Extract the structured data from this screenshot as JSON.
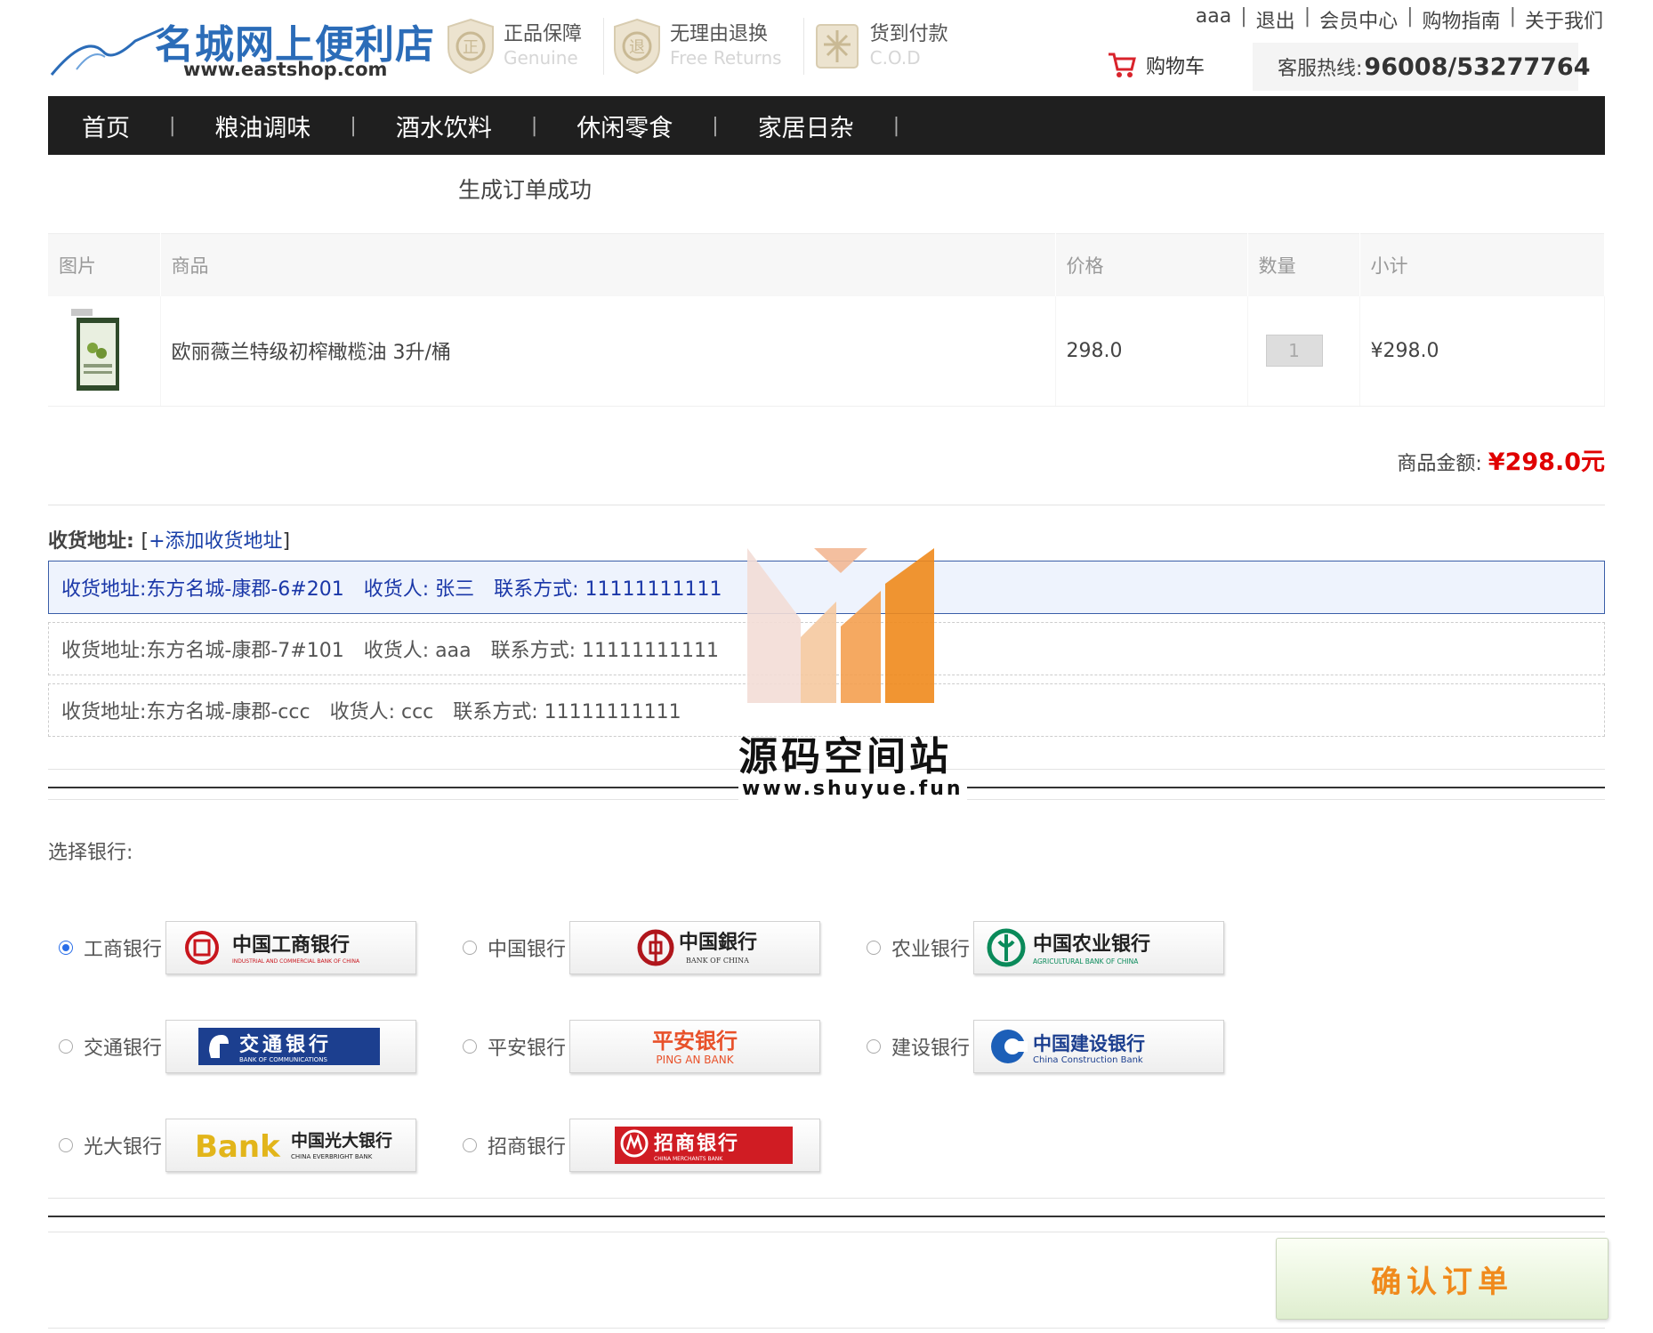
{
  "header": {
    "logo_title": "名城网上便利店",
    "logo_url": "www.eastshop.com",
    "guarantees": [
      {
        "main": "正品保障",
        "sub": "Genuine",
        "icon": "shield-genuine-icon"
      },
      {
        "main": "无理由退换",
        "sub": "Free Returns",
        "icon": "shield-returns-icon"
      },
      {
        "main": "货到付款",
        "sub": "C.O.D",
        "icon": "cod-icon"
      }
    ],
    "top_links": [
      "aaa",
      "退出",
      "会员中心",
      "购物指南",
      "关于我们"
    ],
    "cart_label": "购物车",
    "hotline_label": "客服热线:",
    "hotline_number": "96008/53277764"
  },
  "nav": {
    "items": [
      "首页",
      "粮油调味",
      "酒水饮料",
      "休闲零食",
      "家居日杂"
    ],
    "separator": "|"
  },
  "order": {
    "title": "生成订单成功",
    "columns": [
      "图片",
      "商品",
      "价格",
      "数量",
      "小计"
    ],
    "items": [
      {
        "name": "欧丽薇兰特级初榨橄榄油 3升/桶",
        "price": "298.0",
        "quantity": "1",
        "subtotal": "¥298.0"
      }
    ],
    "total_label": "商品金额:",
    "total_value": "¥298.0元"
  },
  "address": {
    "heading": "收货地址:",
    "add_link": "+添加收货地址",
    "bracket_open": "[",
    "bracket_close": "]",
    "entries": [
      {
        "addr": "收货地址:东方名城-康郡-6#201",
        "receiver": "收货人: 张三",
        "contact": "联系方式: 11111111111",
        "selected": true
      },
      {
        "addr": "收货地址:东方名城-康郡-7#101",
        "receiver": "收货人: aaa",
        "contact": "联系方式: 11111111111",
        "selected": false
      },
      {
        "addr": "收货地址:东方名城-康郡-ccc",
        "receiver": "收货人: ccc",
        "contact": "联系方式: 11111111111",
        "selected": false
      }
    ]
  },
  "payment": {
    "label": "选择银行:",
    "banks": [
      {
        "name": "工商银行",
        "logo_text": "中国工商银行",
        "logo_sub": "INDUSTRIAL AND COMMERCIAL BANK OF CHINA",
        "checked": true
      },
      {
        "name": "中国银行",
        "logo_text": "中国銀行",
        "logo_sub": "BANK OF CHINA",
        "checked": false
      },
      {
        "name": "农业银行",
        "logo_text": "中国农业银行",
        "logo_sub": "AGRICULTURAL BANK OF CHINA",
        "checked": false
      },
      {
        "name": "交通银行",
        "logo_text": "交通银行",
        "logo_sub": "BANK OF COMMUNICATIONS",
        "checked": false
      },
      {
        "name": "平安银行",
        "logo_text": "平安银行",
        "logo_sub": "PING AN BANK",
        "checked": false
      },
      {
        "name": "建设银行",
        "logo_text": "中国建设银行",
        "logo_sub": "China Construction Bank",
        "checked": false
      },
      {
        "name": "光大银行",
        "logo_text": "中国光大银行",
        "logo_sub": "CHINA EVERBRIGHT BANK",
        "logo_brand": "Bank",
        "checked": false
      },
      {
        "name": "招商银行",
        "logo_text": "招商银行",
        "logo_sub": "CHINA MERCHANTS BANK",
        "checked": false
      }
    ],
    "confirm_label": "确认订单"
  },
  "watermark": {
    "name": "源码空间站",
    "url": "www.shuyue.fun"
  },
  "colors": {
    "brand_blue": "#2b6cb8",
    "nav_bg": "#1f1f1f",
    "price_red": "#e00000",
    "confirm_orange": "#f08a1c",
    "selected_border": "#3a5ea8"
  }
}
